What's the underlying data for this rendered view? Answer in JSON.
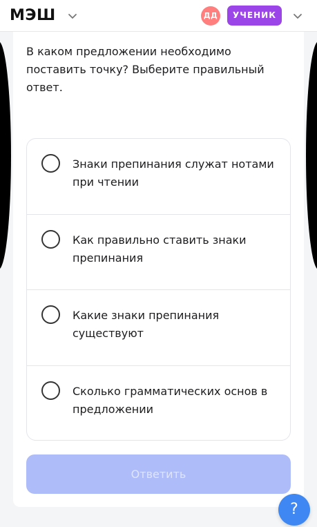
{
  "header": {
    "logo": "МЭШ",
    "logo_menu_icon": "chevron-down-icon",
    "avatar_initials": "ДД",
    "role": "УЧЕНИК",
    "user_menu_icon": "chevron-down-icon"
  },
  "colors": {
    "avatar": "#ff7f7f",
    "role_badge": "#9b45e8",
    "submit_disabled": "#aebcfa",
    "help_button": "#3f87f2"
  },
  "question": {
    "text": "В каком предложении необходимо поставить точку? Выберите правильный ответ."
  },
  "options": [
    {
      "label": "Знаки препинания служат нотами при чтении"
    },
    {
      "label": "Как правильно ставить знаки препинания"
    },
    {
      "label": "Какие знаки препинания существуют"
    },
    {
      "label": "Сколько грамматических основ в предложении"
    }
  ],
  "submit": {
    "label": "Ответить"
  },
  "help": {
    "label": "?"
  }
}
